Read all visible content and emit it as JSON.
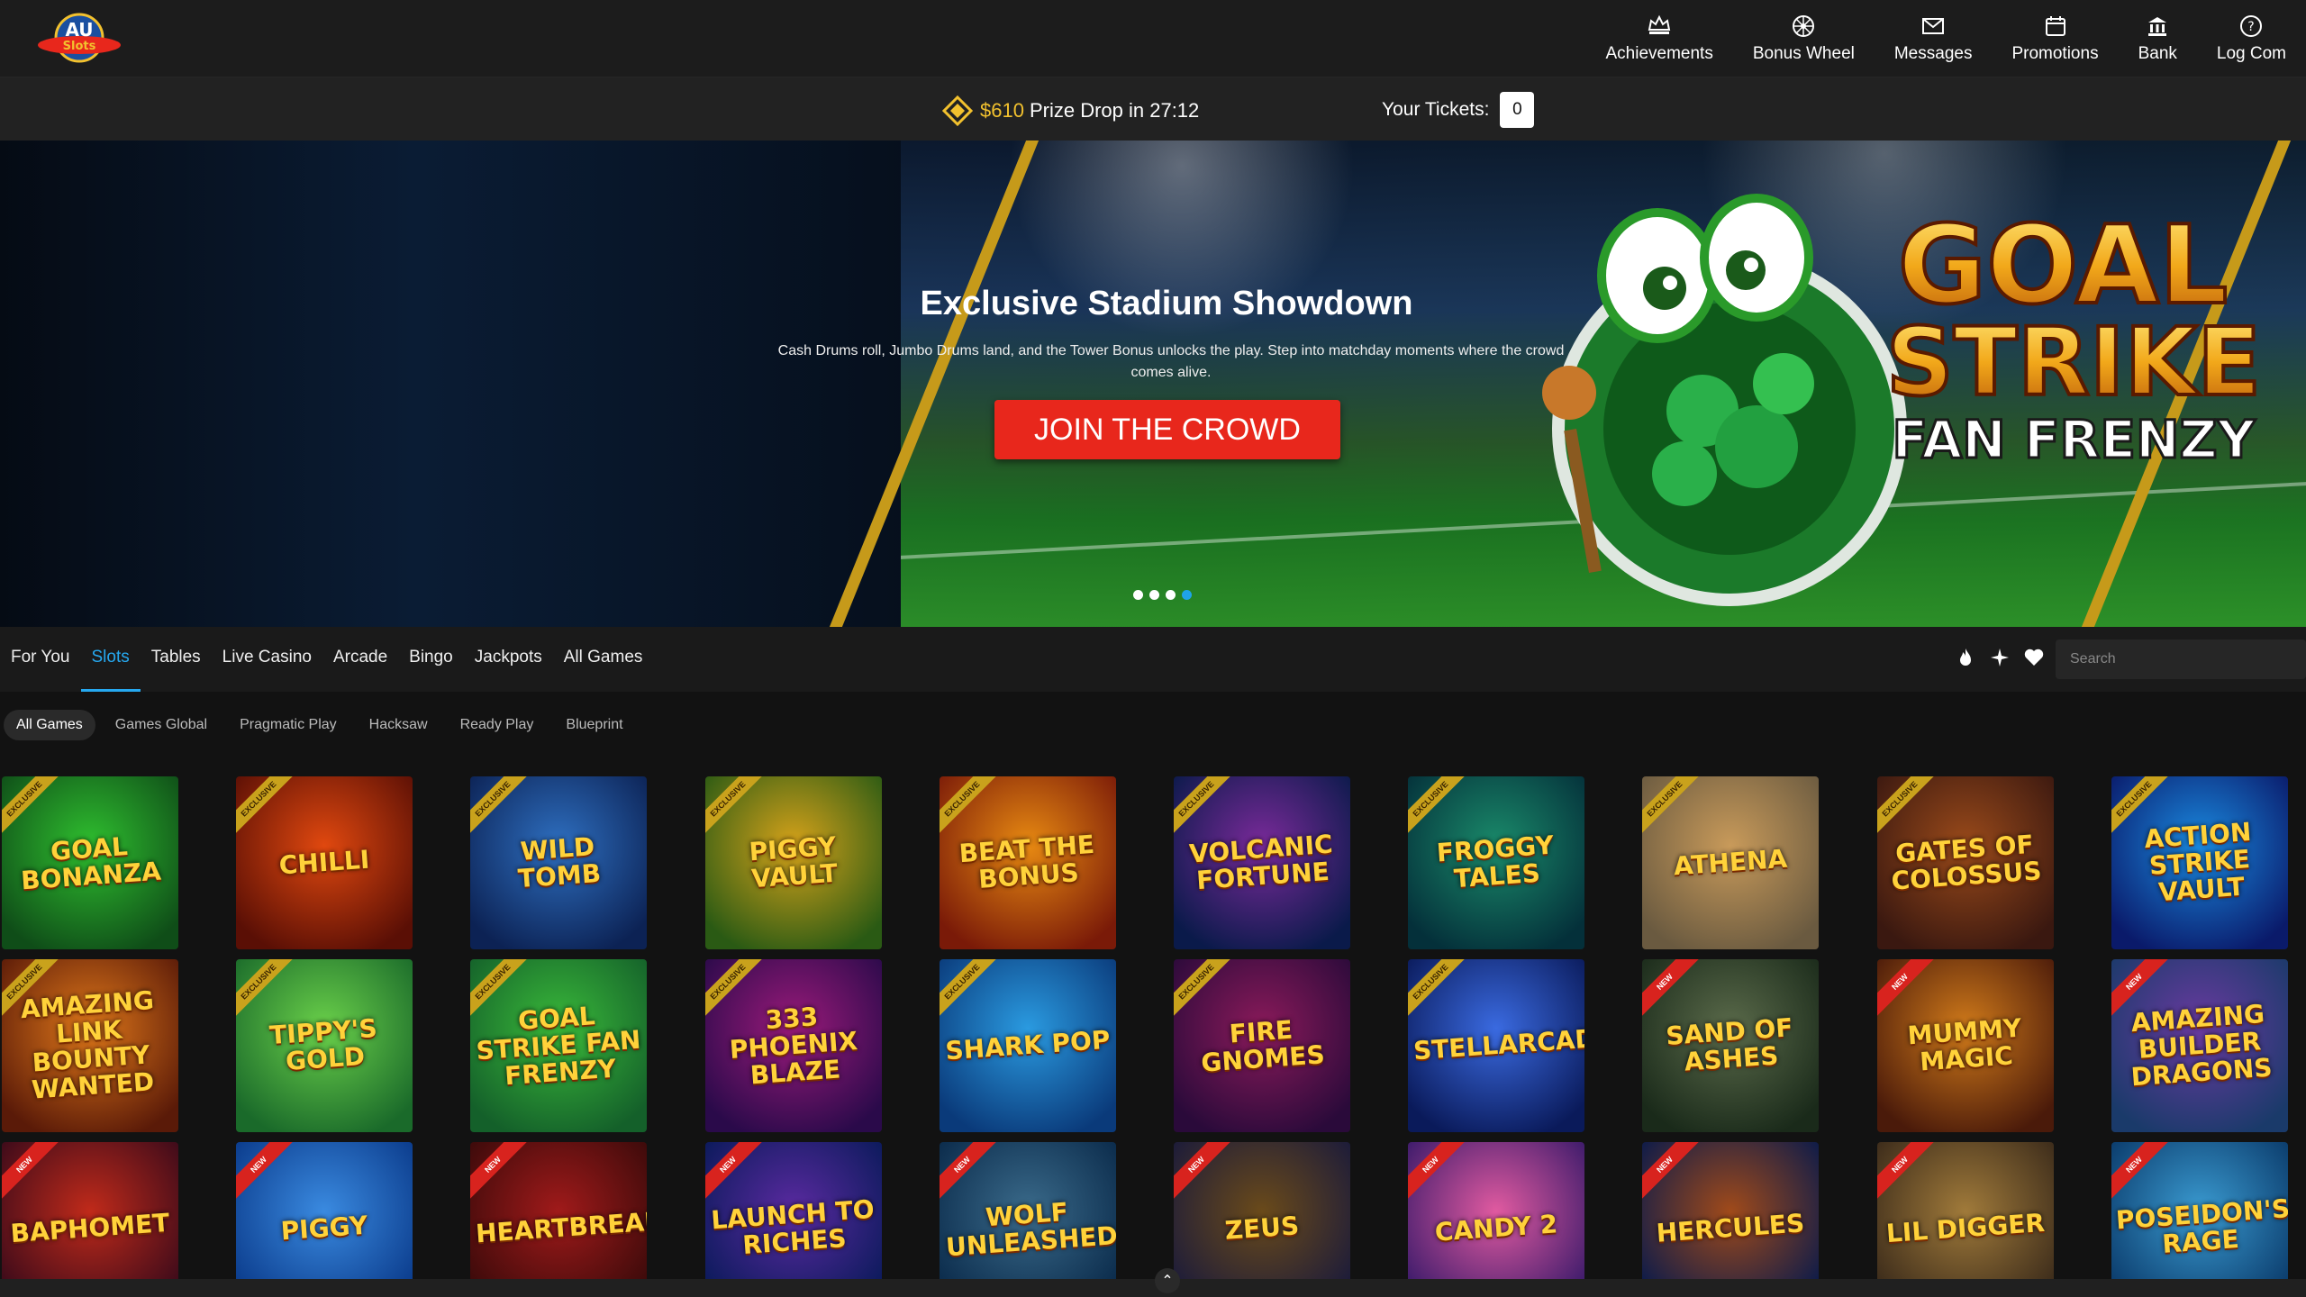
{
  "header": {
    "logo_text": "AU Slots",
    "nav": [
      {
        "label": "Achievements",
        "icon": "crown-icon"
      },
      {
        "label": "Bonus Wheel",
        "icon": "wheel-icon"
      },
      {
        "label": "Messages",
        "icon": "envelope-icon"
      },
      {
        "label": "Promotions",
        "icon": "calendar-icon"
      },
      {
        "label": "Bank",
        "icon": "bank-icon"
      },
      {
        "label": "Log Com",
        "icon": "help-icon"
      }
    ]
  },
  "prize_bar": {
    "amount": "$610",
    "label": "Prize Drop in 27:12",
    "tickets_label": "Your Tickets:",
    "tickets_value": "0"
  },
  "hero": {
    "title": "Exclusive Stadium Showdown",
    "subtitle": "Cash Drums roll, Jumbo Drums land, and the Tower Bonus unlocks the play. Step into matchday moments where the crowd comes alive.",
    "cta": "JOIN THE CROWD",
    "game_logo_line1": "GOAL",
    "game_logo_line2": "STRIKE",
    "game_logo_line3": "FAN FRENZY",
    "slides": 4,
    "active_slide": 4
  },
  "tabs": [
    "For You",
    "Slots",
    "Tables",
    "Live Casino",
    "Arcade",
    "Bingo",
    "Jackpots",
    "All Games"
  ],
  "active_tab": "Slots",
  "search": {
    "placeholder": "Search"
  },
  "providers": [
    "All Games",
    "Games Global",
    "Pragmatic Play",
    "Hacksaw",
    "Ready Play",
    "Blueprint"
  ],
  "colors": {
    "accent": "#26a8ef",
    "cta": "#e8271c",
    "gold": "#f2c12e"
  },
  "games": [
    {
      "title": "GOAL BONANZA",
      "ribbon": "EXCLUSIVE",
      "bg": [
        "#0f4d18",
        "#2fbf2f"
      ]
    },
    {
      "title": "CHILLI",
      "ribbon": "EXCLUSIVE",
      "bg": [
        "#5a0f05",
        "#e0480f"
      ]
    },
    {
      "title": "WILD TOMB",
      "ribbon": "EXCLUSIVE",
      "bg": [
        "#0c2254",
        "#2e6fc0"
      ]
    },
    {
      "title": "PIGGY VAULT",
      "ribbon": "EXCLUSIVE",
      "bg": [
        "#2a5a14",
        "#d6a21a"
      ]
    },
    {
      "title": "BEAT THE BONUS",
      "ribbon": "EXCLUSIVE",
      "bg": [
        "#7a1a08",
        "#e88a12"
      ]
    },
    {
      "title": "VOLCANIC FORTUNE",
      "ribbon": "EXCLUSIVE",
      "bg": [
        "#0a1a4a",
        "#7a2a9a"
      ]
    },
    {
      "title": "FROGGY TALES",
      "ribbon": "EXCLUSIVE",
      "bg": [
        "#04303a",
        "#1a8a6a"
      ]
    },
    {
      "title": "ATHENA",
      "ribbon": "EXCLUSIVE",
      "bg": [
        "#6a5a40",
        "#c89a5a"
      ]
    },
    {
      "title": "GATES OF COLOSSUS",
      "ribbon": "EXCLUSIVE",
      "bg": [
        "#3a1810",
        "#9a4a1a"
      ]
    },
    {
      "title": "ACTION STRIKE VAULT",
      "ribbon": "EXCLUSIVE",
      "bg": [
        "#0a1a6a",
        "#1a8ae0"
      ]
    },
    {
      "title": "AMAZING LINK BOUNTY WANTED",
      "ribbon": "EXCLUSIVE",
      "bg": [
        "#5a1a08",
        "#e0781a"
      ]
    },
    {
      "title": "TIPPY'S GOLD",
      "ribbon": "EXCLUSIVE",
      "bg": [
        "#1a6a2a",
        "#6ad04a"
      ]
    },
    {
      "title": "GOAL STRIKE FAN FRENZY",
      "ribbon": "EXCLUSIVE",
      "bg": [
        "#14602a",
        "#3aba3a"
      ]
    },
    {
      "title": "333 PHOENIX BLAZE",
      "ribbon": "EXCLUSIVE",
      "bg": [
        "#2a0a4a",
        "#9a1a7a"
      ]
    },
    {
      "title": "SHARK POP",
      "ribbon": "EXCLUSIVE",
      "bg": [
        "#0a3a7a",
        "#2a9ae0"
      ]
    },
    {
      "title": "FIRE GNOMES",
      "ribbon": "EXCLUSIVE",
      "bg": [
        "#2a0a3a",
        "#8a1a5a"
      ]
    },
    {
      "title": "STELLARCADE",
      "ribbon": "EXCLUSIVE",
      "bg": [
        "#0a1a5a",
        "#3a6ae0"
      ]
    },
    {
      "title": "SAND OF ASHES",
      "ribbon": "NEW",
      "bg": [
        "#1a2a1a",
        "#5a6a4a"
      ]
    },
    {
      "title": "MUMMY MAGIC",
      "ribbon": "NEW",
      "bg": [
        "#4a1a0a",
        "#d07a1a"
      ]
    },
    {
      "title": "AMAZING BUILDER DRAGONS",
      "ribbon": "NEW",
      "bg": [
        "#1a3a6a",
        "#6a3aa0"
      ]
    },
    {
      "title": "BAPHOMET",
      "ribbon": "NEW",
      "bg": [
        "#3a0a1a",
        "#c02a1a"
      ]
    },
    {
      "title": "PIGGY",
      "ribbon": "NEW",
      "bg": [
        "#0a3a8a",
        "#3a8ae0"
      ]
    },
    {
      "title": "HEARTBREAKERS",
      "ribbon": "NEW",
      "bg": [
        "#3a0a0a",
        "#a01a1a"
      ]
    },
    {
      "title": "LAUNCH TO RICHES",
      "ribbon": "NEW",
      "bg": [
        "#0a1a5a",
        "#5a2aa0"
      ]
    },
    {
      "title": "WOLF UNLEASHED",
      "ribbon": "NEW",
      "bg": [
        "#0a2a4a",
        "#3a6a8a"
      ]
    },
    {
      "title": "ZEUS",
      "ribbon": "NEW",
      "bg": [
        "#1a1a3a",
        "#6a4a1a"
      ]
    },
    {
      "title": "CANDY 2",
      "ribbon": "NEW",
      "bg": [
        "#3a1a6a",
        "#e05aa0"
      ]
    },
    {
      "title": "HERCULES",
      "ribbon": "NEW",
      "bg": [
        "#0a1a4a",
        "#a04a1a"
      ]
    },
    {
      "title": "LIL DIGGER",
      "ribbon": "NEW",
      "bg": [
        "#3a2a1a",
        "#a07a3a"
      ]
    },
    {
      "title": "POSEIDON'S RAGE",
      "ribbon": "NEW",
      "bg": [
        "#0a3a6a",
        "#3a9ad0"
      ]
    }
  ]
}
